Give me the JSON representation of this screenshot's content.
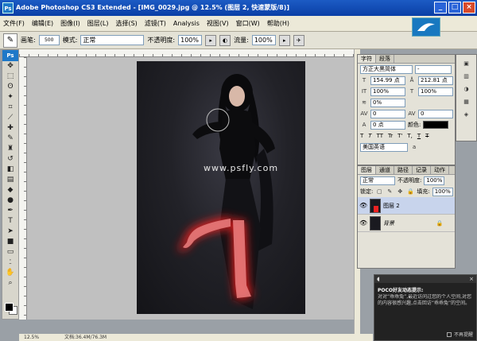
{
  "titlebar": {
    "app_badge": "Ps",
    "title": "Adobe Photoshop CS3 Extended - [IMG_0029.jpg @ 12.5% (图层 2, 快速蒙版/8)]",
    "min": "_",
    "max": "□",
    "close": "×"
  },
  "menu": [
    "文件(F)",
    "编辑(E)",
    "图像(I)",
    "图层(L)",
    "选择(S)",
    "滤镜(T)",
    "Analysis",
    "视图(V)",
    "窗口(W)",
    "帮助(H)"
  ],
  "options": {
    "brush_label": "画笔:",
    "brush_size": "500",
    "mode_label": "模式:",
    "mode_value": "正常",
    "opacity_label": "不透明度:",
    "opacity_value": "100%",
    "flow_label": "流量:",
    "flow_value": "100%"
  },
  "toolbox": {
    "header": "Ps",
    "tools": [
      "move-icon",
      "marquee-icon",
      "lasso-icon",
      "magic-wand-icon",
      "crop-icon",
      "slice-icon",
      "healing-icon",
      "brush-icon",
      "stamp-icon",
      "history-brush-icon",
      "eraser-icon",
      "gradient-icon",
      "blur-icon",
      "dodge-icon",
      "pen-icon",
      "type-icon",
      "path-select-icon",
      "shape-icon",
      "notes-icon",
      "eyedropper-icon",
      "hand-icon",
      "zoom-icon"
    ]
  },
  "canvas": {
    "watermark": "www.psfly.com"
  },
  "status": {
    "zoom": "12.5%",
    "doc": "文档:36.4M/76.3M"
  },
  "char_panel": {
    "tabs": [
      "字符",
      "段落"
    ],
    "font_family": "方正大黑简体",
    "font_style": "-",
    "size": "154.99 点",
    "leading": "212.81 点",
    "vscale": "100%",
    "hscale": "100%",
    "tracking_pct": "0%",
    "kerning": "0",
    "tracking": "0",
    "baseline": "0 点",
    "color_label": "颜色:",
    "text_color": "#000000",
    "style_buttons": [
      "T",
      "T",
      "TT",
      "Tr",
      "T'",
      "T,",
      "T",
      "T"
    ],
    "lang": "美国英语",
    "aa": "a"
  },
  "layers_panel": {
    "tabs": [
      "图层",
      "通道",
      "路径",
      "记录",
      "动作"
    ],
    "blend_mode": "正常",
    "opacity_label": "不透明度:",
    "opacity": "100%",
    "lock_label": "锁定:",
    "fill_label": "填充:",
    "fill": "100%",
    "layers": [
      {
        "name": "图层 2"
      },
      {
        "name": "背景"
      }
    ]
  },
  "popup": {
    "title": "POCO好友动态提示:",
    "body": "对对“乖乖兔”,最近访问过您的个人空间,对您的内容很感兴趣,点击回访“乖乖兔”的空间。",
    "dont_remind": "不再提醒"
  }
}
